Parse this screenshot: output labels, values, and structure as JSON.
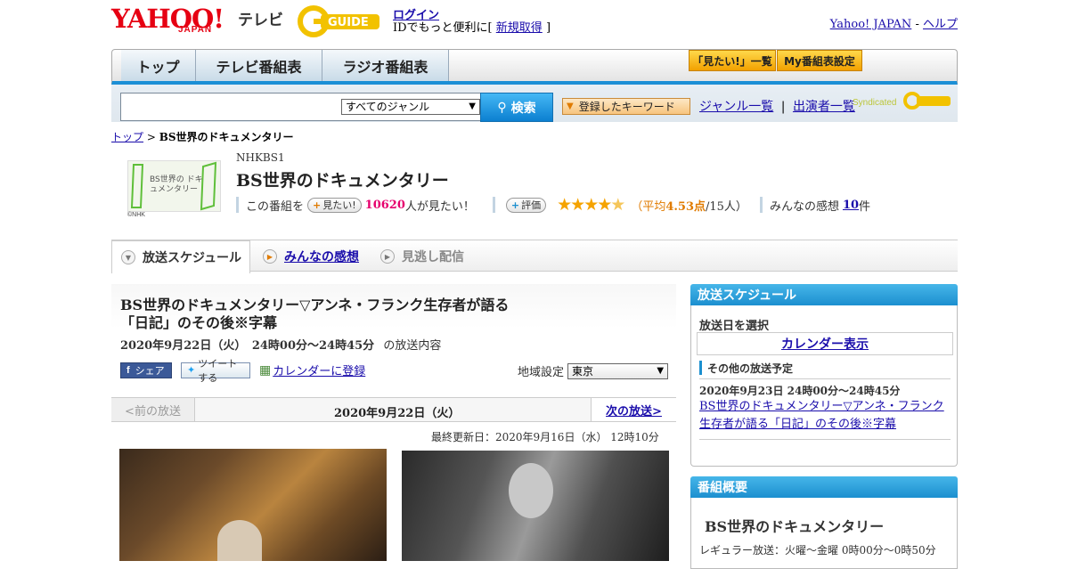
{
  "header": {
    "logo_text": "YAHOO!",
    "logo_sub": "JAPAN",
    "service": "テレビ",
    "gguide_logo": "G GUIDE",
    "login_label": "ログイン",
    "login_prompt": "IDでもっと便利に[",
    "signup_label": "新規取得",
    "signup_suffix": "]",
    "yahoo_link": "Yahoo! JAPAN",
    "separator": "-",
    "help_link": "ヘルプ"
  },
  "nav": {
    "tabs": [
      {
        "label": "トップ"
      },
      {
        "label": "テレビ番組表"
      },
      {
        "label": "ラジオ番組表"
      }
    ],
    "wantlist_label": "「見たい!」一覧",
    "mylist_label": "My番組表設定"
  },
  "search": {
    "input_value": "",
    "genre_selected": "すべてのジャンル",
    "search_button": "検索",
    "keyword_button": "登録したキーワード",
    "genre_link": "ジャンル一覧",
    "divider": "|",
    "performer_link": "出演者一覧",
    "syndicated": "Syndicated"
  },
  "breadcrumb": {
    "home": "トップ",
    "sep": ">",
    "current": "BS世界のドキュメンタリー"
  },
  "program": {
    "channel": "NHKBS1",
    "title": "BS世界のドキュメンタリー",
    "thumb_text": "BS世界の ドキュメンタリー",
    "thumb_credit": "©NHK",
    "want_prefix": "この番組を",
    "want_button": "見たい!",
    "want_count": "10620",
    "want_suffix": "人が見たい！",
    "rate_button": "評価",
    "rating_stars": 4.53,
    "rating_open": "（平均",
    "rating_avg": "4.53点",
    "rating_count": "/15人）",
    "comments_prefix": "みんなの感想",
    "comments_count": "10",
    "comments_suffix": "件"
  },
  "tabs": [
    {
      "label": "放送スケジュール"
    },
    {
      "label": "みんなの感想"
    },
    {
      "label": "見逃し配信"
    }
  ],
  "episode": {
    "title": "BS世界のドキュメンタリー▽アンネ・フランク生存者が語る「日記」のその後※字幕",
    "date": "2020年9月22日（火）　24時00分～24時45分",
    "date_suffix": "の放送内容",
    "share_fb": "シェア",
    "share_tw": "ツイートする",
    "calendar_link": "カレンダーに登録",
    "region_label": "地域設定",
    "region_value": "東京"
  },
  "daynav": {
    "prev": "<前の放送",
    "current": "2020年9月22日（火）",
    "next": "次の放送>"
  },
  "updated": "最終更新日：2020年9月16日（水）  12時10分",
  "side_schedule": {
    "header": "放送スケジュール",
    "select_day": "放送日を選択",
    "calendar_link": "カレンダー表示",
    "other_heading": "その他の放送予定",
    "other_date": "2020年9月23日  24時00分～24時45分",
    "other_title": "BS世界のドキュメンタリー▽アンネ・フランク生存者が語る「日記」のその後※字幕"
  },
  "side_summary": {
    "header": "番組概要",
    "title": "BS世界のドキュメンタリー",
    "regular": "レギュラー放送：火曜～金曜  0時00分～0時50分"
  },
  "colors": {
    "nav_accent": "#1b8fd6",
    "yahoo_red": "#e60012",
    "want_count": "#e6006e",
    "rating": "#e07b00",
    "star": "#f5a300"
  }
}
